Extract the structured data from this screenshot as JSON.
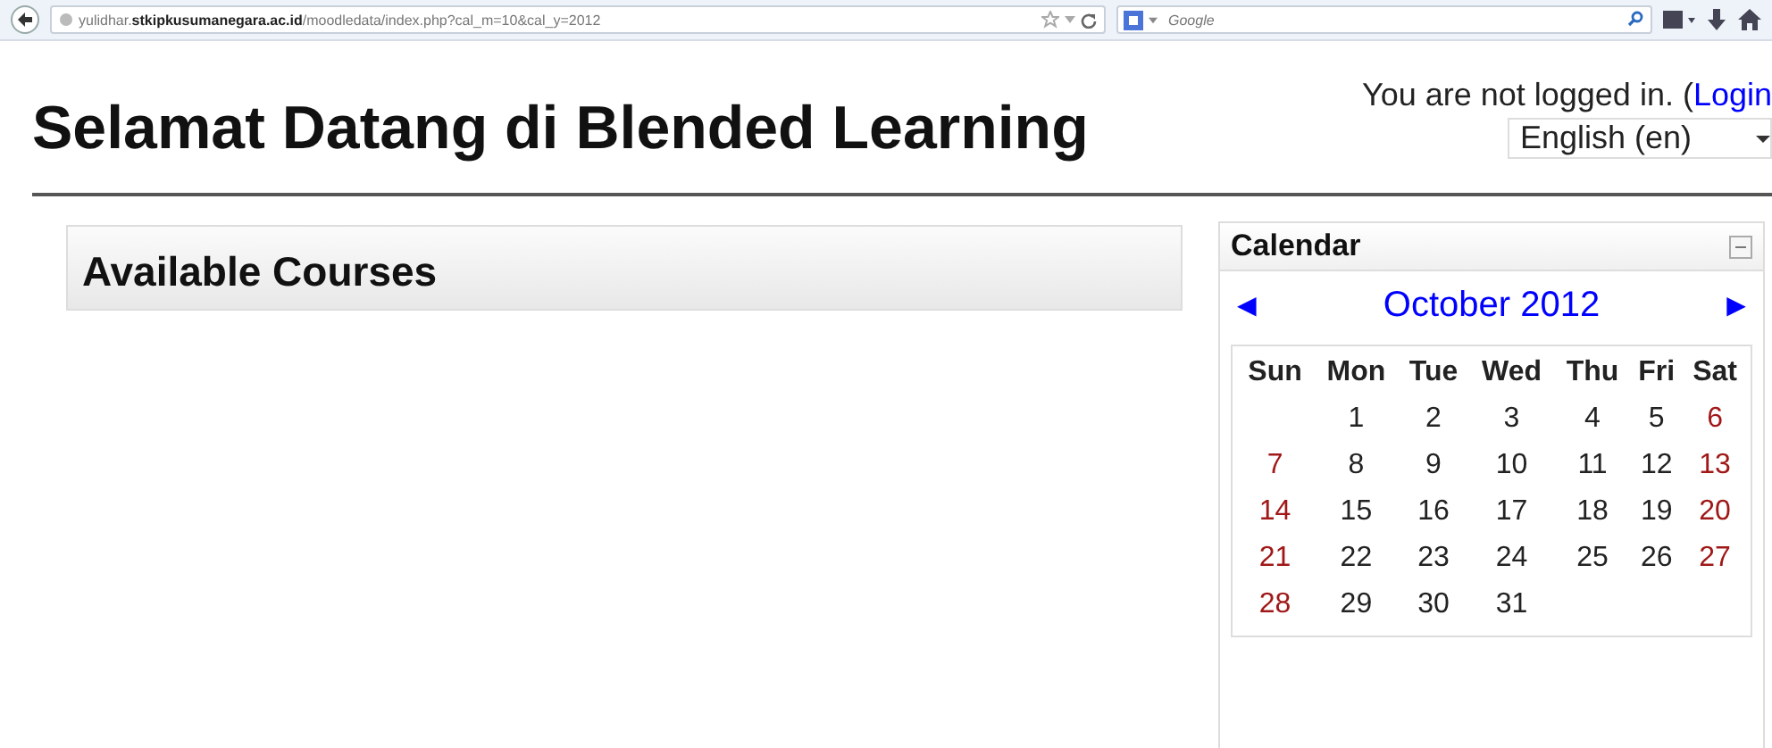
{
  "browser": {
    "url_host_prefix": "yulidhar.",
    "url_domain": "stkipkusumanegara.ac.id",
    "url_path": "/moodledata/index.php?cal_m=10&cal_y=2012",
    "search_placeholder": "Google"
  },
  "header": {
    "title": "Selamat Datang di Blended Learning",
    "login_text": "You are not logged in. (",
    "login_link": "Login",
    "language": "English (en)"
  },
  "courses": {
    "title": "Available Courses"
  },
  "calendar": {
    "title": "Calendar",
    "prev": "◄",
    "month": "October 2012",
    "next": "►",
    "weekdays": [
      {
        "label": "Sun",
        "weekend": false
      },
      {
        "label": "Mon",
        "weekend": false
      },
      {
        "label": "Tue",
        "weekend": false
      },
      {
        "label": "Wed",
        "weekend": false
      },
      {
        "label": "Thu",
        "weekend": false
      },
      {
        "label": "Fri",
        "weekend": false
      },
      {
        "label": "Sat",
        "weekend": false
      }
    ],
    "weeks": [
      {
        "blanks_before": true,
        "days": [
          {
            "label": "1",
            "weekend": false
          },
          {
            "label": "2",
            "weekend": false
          },
          {
            "label": "3",
            "weekend": false
          },
          {
            "label": "4",
            "weekend": false
          },
          {
            "label": "5",
            "weekend": false
          },
          {
            "label": "6",
            "weekend": true
          }
        ]
      },
      {
        "blanks_before": false,
        "days": [
          {
            "label": "7",
            "weekend": true
          },
          {
            "label": "8",
            "weekend": false
          },
          {
            "label": "9",
            "weekend": false
          },
          {
            "label": "10",
            "weekend": false
          },
          {
            "label": "11",
            "weekend": false
          },
          {
            "label": "12",
            "weekend": false
          },
          {
            "label": "13",
            "weekend": true
          }
        ]
      },
      {
        "blanks_before": false,
        "days": [
          {
            "label": "14",
            "weekend": true
          },
          {
            "label": "15",
            "weekend": false
          },
          {
            "label": "16",
            "weekend": false
          },
          {
            "label": "17",
            "weekend": false
          },
          {
            "label": "18",
            "weekend": false
          },
          {
            "label": "19",
            "weekend": false
          },
          {
            "label": "20",
            "weekend": true
          }
        ]
      },
      {
        "blanks_before": false,
        "days": [
          {
            "label": "21",
            "weekend": true
          },
          {
            "label": "22",
            "weekend": false
          },
          {
            "label": "23",
            "weekend": false
          },
          {
            "label": "24",
            "weekend": false
          },
          {
            "label": "25",
            "weekend": false
          },
          {
            "label": "26",
            "weekend": false
          },
          {
            "label": "27",
            "weekend": true
          }
        ]
      },
      {
        "blanks_before": false,
        "days": [
          {
            "label": "28",
            "weekend": true
          },
          {
            "label": "29",
            "weekend": false
          },
          {
            "label": "30",
            "weekend": false
          },
          {
            "label": "31",
            "weekend": false
          }
        ]
      }
    ]
  }
}
